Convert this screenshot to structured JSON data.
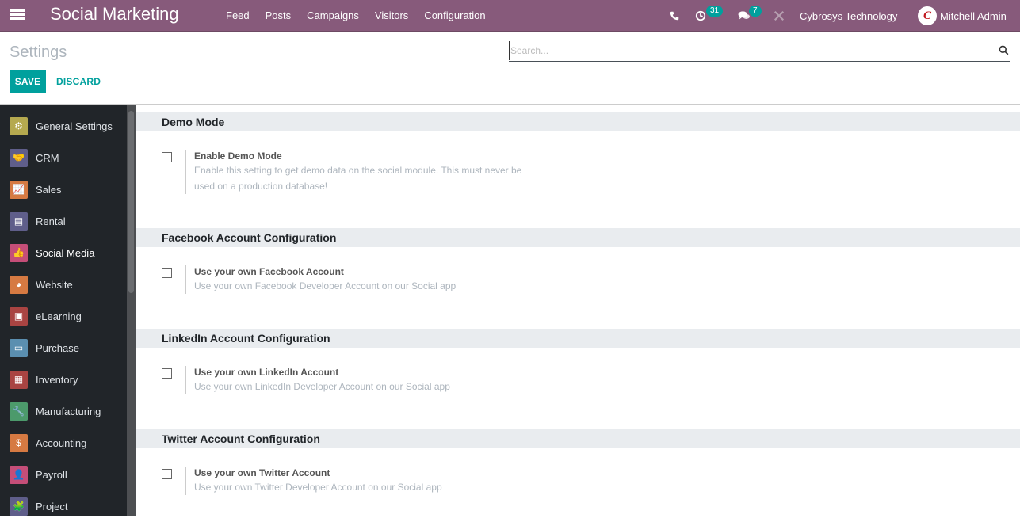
{
  "navbar": {
    "brand": "Social Marketing",
    "menu": [
      "Feed",
      "Posts",
      "Campaigns",
      "Visitors",
      "Configuration"
    ],
    "activity_count": "31",
    "messages_count": "7",
    "company": "Cybrosys Technology",
    "user": "Mitchell Admin",
    "icons": [
      "apps-icon",
      "phone-icon",
      "activity-clock-icon",
      "chat-icon",
      "debug-tools-icon"
    ]
  },
  "control_panel": {
    "breadcrumb": "Settings",
    "save_label": "SAVE",
    "discard_label": "DISCARD",
    "search_placeholder": "Search..."
  },
  "sidebar": {
    "items": [
      {
        "label": "General Settings",
        "icon": "gear-icon",
        "color": "#b5a94f",
        "glyph": "⚙"
      },
      {
        "label": "CRM",
        "icon": "handshake-icon",
        "color": "#5f5e8a",
        "glyph": "🤝"
      },
      {
        "label": "Sales",
        "icon": "chart-up-icon",
        "color": "#d67a42",
        "glyph": "📈"
      },
      {
        "label": "Rental",
        "icon": "rental-icon",
        "color": "#5f5e8a",
        "glyph": "▤"
      },
      {
        "label": "Social Media",
        "icon": "thumbs-up-icon",
        "color": "#c54e78",
        "glyph": "👍",
        "active": true
      },
      {
        "label": "Website",
        "icon": "globe-icon",
        "color": "#d67a42",
        "glyph": "◕"
      },
      {
        "label": "eLearning",
        "icon": "elearning-icon",
        "color": "#a94442",
        "glyph": "▣"
      },
      {
        "label": "Purchase",
        "icon": "credit-card-icon",
        "color": "#5b8fb0",
        "glyph": "▭"
      },
      {
        "label": "Inventory",
        "icon": "box-icon",
        "color": "#a94442",
        "glyph": "▦"
      },
      {
        "label": "Manufacturing",
        "icon": "wrench-icon",
        "color": "#4c9a6b",
        "glyph": "🔧"
      },
      {
        "label": "Accounting",
        "icon": "invoice-dollar-icon",
        "color": "#d67a42",
        "glyph": "$"
      },
      {
        "label": "Payroll",
        "icon": "payroll-icon",
        "color": "#c54e78",
        "glyph": "👤"
      },
      {
        "label": "Project",
        "icon": "puzzle-icon",
        "color": "#5f5e8a",
        "glyph": "🧩"
      }
    ]
  },
  "sections": [
    {
      "title": "Demo Mode",
      "setting_title": "Enable Demo Mode",
      "setting_desc": "Enable this setting to get demo data on the social module. This must never be used on a production database!",
      "checked": false
    },
    {
      "title": "Facebook Account Configuration",
      "setting_title": "Use your own Facebook Account",
      "setting_desc": "Use your own Facebook Developer Account on our Social app",
      "checked": false
    },
    {
      "title": "LinkedIn Account Configuration",
      "setting_title": "Use your own LinkedIn Account",
      "setting_desc": "Use your own LinkedIn Developer Account on our Social app",
      "checked": false
    },
    {
      "title": "Twitter Account Configuration",
      "setting_title": "Use your own Twitter Account",
      "setting_desc": "Use your own Twitter Developer Account on our Social app",
      "checked": false
    }
  ],
  "colors": {
    "navbar": "#875a7b",
    "accent": "#00a09d",
    "sidebar": "#212529"
  }
}
